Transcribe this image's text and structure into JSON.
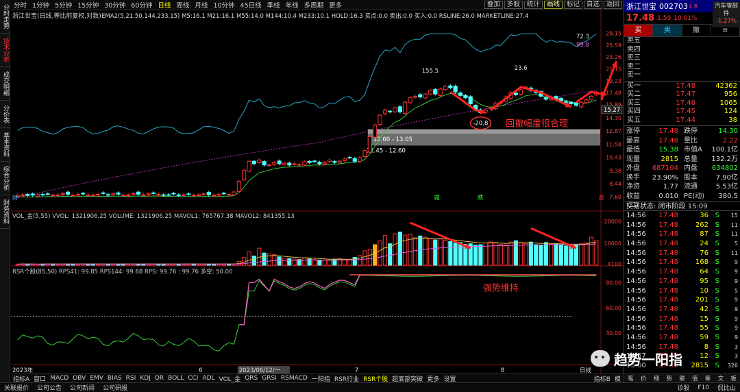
{
  "side_tabs": [
    "分时走势",
    "技术分析",
    "成交明细",
    "分价表",
    "基本资料",
    "综合分析",
    "财务资料"
  ],
  "side_active": 1,
  "topbar": {
    "left": [
      "分时",
      "1分钟",
      "5分钟",
      "15分钟",
      "30分钟",
      "60分钟",
      "日线",
      "周线",
      "月线",
      "10分钟",
      "45日线",
      "季线",
      "年线",
      "多周期",
      "更多"
    ],
    "active": "日线",
    "right": [
      "叠加",
      "多股",
      "统计",
      "画线",
      "标记",
      "自选",
      "返回"
    ],
    "right_on": "画线"
  },
  "chart_data": {
    "type": "candlestick",
    "title": "浙江世宝(日线,等比前复权,对数)",
    "indicator_line": "EMA2(5,21,50,144,233,15) M5:16.1 M21:16.1 M55:14.0 M144:10.4 M233:10.1 HOLD:16.3 买点:0.0 卖出:0.0 买入:0.0 RSLINE:26.0 MARKETLINE:27.4",
    "price_axis": [
      "28.15",
      "25.59",
      "23.26",
      "21.15",
      "19.23",
      "17.48",
      "15.89",
      "14.30",
      "12.87",
      "11.58",
      "10.43",
      "9.38",
      "8.44",
      "7.60"
    ],
    "current_price_tag": "15.27",
    "annotations": {
      "high_label": "155.5",
      "mid_label": "23.6",
      "neg_label": "-20.8",
      "blue_top1": "72.3",
      "blue_top2": "99.8",
      "zone_upper": "12.60 - 13.05",
      "zone_lower": "11.45 - 12.60",
      "comment": "回撤幅度很合理",
      "markers": [
        "减",
        "跌",
        "涨"
      ],
      "cw": "财"
    },
    "vol_header": "VOL_金(5,55) VVOL: 1321906.25 VOLUME: 1321906.25 MAVOL1: 765767.38 MAVOL2: 841355.13",
    "vol_axis": [
      "20000",
      "10000",
      "X100"
    ],
    "rsr_header": "RSR个股(85,50) RPS41: 99.85 RPS144: 99.68 RPS: 99.76 : 99.76 多空: 50.00",
    "rsr_axis": [
      "90.00",
      "60.00",
      "30.00"
    ],
    "rsr_comment": "强势维持",
    "date_axis": [
      "2023年",
      "6",
      "2023/06/12/一",
      "7",
      "8",
      "日线"
    ],
    "closes": [
      7.7,
      7.72,
      7.68,
      7.7,
      7.75,
      7.72,
      7.78,
      7.7,
      7.72,
      7.8,
      7.75,
      7.7,
      7.75,
      7.8,
      7.72,
      7.7,
      7.75,
      7.8,
      7.72,
      7.78,
      7.76,
      7.7,
      7.72,
      7.8,
      7.75,
      7.72,
      7.78,
      7.8,
      7.75,
      7.7,
      7.72,
      7.78,
      7.68,
      7.72,
      7.75,
      7.7,
      7.73,
      7.78,
      7.72,
      7.7,
      7.76,
      7.8,
      7.75,
      7.9,
      8.6,
      9.4,
      10.1,
      9.9,
      10.2,
      9.8,
      9.8,
      10.0,
      9.9,
      9.95,
      9.8,
      9.9,
      9.85,
      10.05,
      10.0,
      10.1,
      9.9,
      10.0,
      10.2,
      10.0,
      10.1,
      10.3,
      10.4,
      10.1,
      10.4,
      11.0,
      12.3,
      13.5,
      14.6,
      15.2,
      15.0,
      15.5,
      15.0,
      16.2,
      16.8,
      17.0,
      16.9,
      17.3,
      17.8,
      17.3,
      18.0,
      18.4,
      18.2,
      17.6,
      17.1,
      16.8,
      16.0,
      15.3,
      14.9,
      15.2,
      15.5,
      16.1,
      16.2,
      16.9,
      17.5,
      17.2,
      17.9,
      18.3,
      17.8,
      17.5,
      17.0,
      16.6,
      16.9,
      16.5,
      16.4,
      16.2,
      16.0,
      15.8,
      16.2,
      16.5,
      17.0,
      17.5
    ],
    "vols": [
      500,
      600,
      550,
      500,
      480,
      520,
      600,
      550,
      500,
      580,
      560,
      520,
      500,
      600,
      580,
      540,
      520,
      560,
      500,
      480,
      520,
      560,
      600,
      540,
      500,
      520,
      580,
      560,
      500,
      520,
      540,
      500,
      480,
      520,
      600,
      580,
      520,
      500,
      480,
      520,
      540,
      500,
      560,
      600,
      1800,
      3500,
      6200,
      4200,
      7800,
      5600,
      5200,
      4800,
      3800,
      3200,
      3000,
      2800,
      2600,
      3400,
      2900,
      2600,
      2400,
      2300,
      2200,
      2800,
      3000,
      2600,
      2500,
      3600,
      4400,
      6600,
      7200,
      9400,
      11200,
      13600,
      9800,
      14400,
      15200,
      13800,
      14200,
      12600,
      13400,
      12800,
      12200,
      11600,
      12000,
      11400,
      10800,
      10200,
      10400,
      9600,
      9800,
      9200,
      9400,
      10200,
      10600,
      10400,
      9600,
      9200,
      10600,
      11200,
      10400,
      9800,
      10600,
      9400,
      9200,
      10400,
      9600,
      9800,
      9400,
      8800,
      9200,
      9600,
      9800,
      10200,
      12800,
      11200
    ],
    "series_colors": {
      "up": "#ff3232",
      "down": "#52ffff",
      "ma": "#3cc03c",
      "envelope": "#2aa8c8",
      "rsr": "#ff5050",
      "rps": "#ff66cc"
    }
  },
  "right": {
    "name": "浙江世宝",
    "code": "002703",
    "lr": "L R",
    "industry": "汽车零部件",
    "industry_pct": "-1.27%",
    "price": "17.48",
    "change": "1.59",
    "pct": "10.01%",
    "buttons": [
      "买",
      "卖",
      "撤",
      "≡"
    ],
    "asks": [
      {
        "k": "卖五",
        "p": "",
        "v": ""
      },
      {
        "k": "卖四",
        "p": "",
        "v": ""
      },
      {
        "k": "卖三",
        "p": "",
        "v": ""
      },
      {
        "k": "卖二",
        "p": "",
        "v": ""
      },
      {
        "k": "卖一",
        "p": "",
        "v": ""
      }
    ],
    "bids": [
      {
        "k": "买一",
        "p": "17.48",
        "v": "42362"
      },
      {
        "k": "买二",
        "p": "17.47",
        "v": "956"
      },
      {
        "k": "买三",
        "p": "17.46",
        "v": "1065"
      },
      {
        "k": "买四",
        "p": "17.45",
        "v": "124"
      },
      {
        "k": "买五",
        "p": "17.44",
        "v": "38"
      }
    ],
    "quote": [
      [
        {
          "k": "涨停",
          "v": "17.48",
          "c": "red"
        },
        {
          "k": "跌停",
          "v": "14.30",
          "c": "grn"
        }
      ],
      [
        {
          "k": "最高",
          "v": "17.48",
          "c": "red"
        },
        {
          "k": "量比",
          "v": "2.22",
          "c": "red"
        }
      ],
      [
        {
          "k": "最低",
          "v": "15.38",
          "c": "grn"
        },
        {
          "k": "市值A",
          "v": "100.1亿",
          "c": "wht"
        }
      ],
      [
        {
          "k": "现量",
          "v": "2815",
          "c": "yel"
        },
        {
          "k": "总量",
          "v": "132.2万",
          "c": "wht"
        }
      ],
      [
        {
          "k": "外盘",
          "v": "687104",
          "c": "red"
        },
        {
          "k": "内盘",
          "v": "634802",
          "c": "grn"
        }
      ],
      [
        {
          "k": "换手",
          "v": "23.90%",
          "c": "wht"
        },
        {
          "k": "股本",
          "v": "7.90亿",
          "c": "wht"
        }
      ],
      [
        {
          "k": "净资",
          "v": "1.77",
          "c": "wht"
        },
        {
          "k": "流通",
          "v": "5.53亿",
          "c": "wht"
        }
      ],
      [
        {
          "k": "收益(二)",
          "v": "0.010",
          "c": "wht"
        },
        {
          "k": "PE(动)",
          "v": "380.5",
          "c": "wht"
        }
      ]
    ],
    "trade_state": "交易状态: 闭市阶段 15:09",
    "ticks": [
      {
        "t": "14:56",
        "p": "17.48",
        "v": "36",
        "d": "S",
        "r": "15"
      },
      {
        "t": "14:56",
        "p": "17.48",
        "v": "262",
        "d": "S",
        "r": "11"
      },
      {
        "t": "14:56",
        "p": "17.48",
        "v": "87",
        "d": "S",
        "r": "11"
      },
      {
        "t": "14:56",
        "p": "17.48",
        "v": "24",
        "d": "S",
        "r": "5"
      },
      {
        "t": "14:56",
        "p": "17.48",
        "v": "76",
        "d": "S",
        "r": "11"
      },
      {
        "t": "14:56",
        "p": "17.48",
        "v": "168",
        "d": "S",
        "r": "9"
      },
      {
        "t": "14:56",
        "p": "17.48",
        "v": "64",
        "d": "S",
        "r": "9"
      },
      {
        "t": "14:56",
        "p": "17.48",
        "v": "95",
        "d": "S",
        "r": "9"
      },
      {
        "t": "14:56",
        "p": "17.48",
        "v": "10",
        "d": "S",
        "r": "5"
      },
      {
        "t": "14:56",
        "p": "17.48",
        "v": "201",
        "d": "S",
        "r": "9"
      },
      {
        "t": "14:56",
        "p": "17.48",
        "v": "42",
        "d": "S",
        "r": "9"
      },
      {
        "t": "14:56",
        "p": "17.48",
        "v": "15",
        "d": "S",
        "r": "9"
      },
      {
        "t": "14:56",
        "p": "17.48",
        "v": "55",
        "d": "S",
        "r": "9"
      },
      {
        "t": "14:56",
        "p": "17.48",
        "v": "59",
        "d": "S",
        "r": "9"
      },
      {
        "t": "14:56",
        "p": "17.48",
        "v": "8",
        "d": "S",
        "r": "3"
      },
      {
        "t": "14:57",
        "p": "17.48",
        "v": "12",
        "d": "S",
        "r": "3"
      },
      {
        "t": "15:00",
        "p": "17.48",
        "v": "2815",
        "d": "S",
        "r": "326"
      }
    ],
    "footer": [
      "笔",
      "价",
      "细",
      "势",
      "联",
      "值",
      "筹",
      "文",
      "板"
    ]
  },
  "bottombar": {
    "items": [
      "指标A",
      "窗口",
      "MACD",
      "OBV",
      "EMV",
      "BIAS",
      "RSI",
      "KDJ",
      "QR",
      "BOLL",
      "CCI",
      "ADL",
      "VOL_金",
      "QRS",
      "GRSI",
      "RSMACD",
      "一阳指",
      "RSR行业",
      "RSR个股",
      "超底部突破",
      "更多",
      "设置"
    ],
    "active": "RSR个股",
    "right": [
      "指标B",
      "模"
    ]
  },
  "status": {
    "items": [
      "关联报价",
      "公司公告",
      "公司新闻",
      "公司研报"
    ],
    "right": [
      "诊股",
      "F10",
      "侃比山"
    ]
  },
  "watermark": "趋势一阳指"
}
